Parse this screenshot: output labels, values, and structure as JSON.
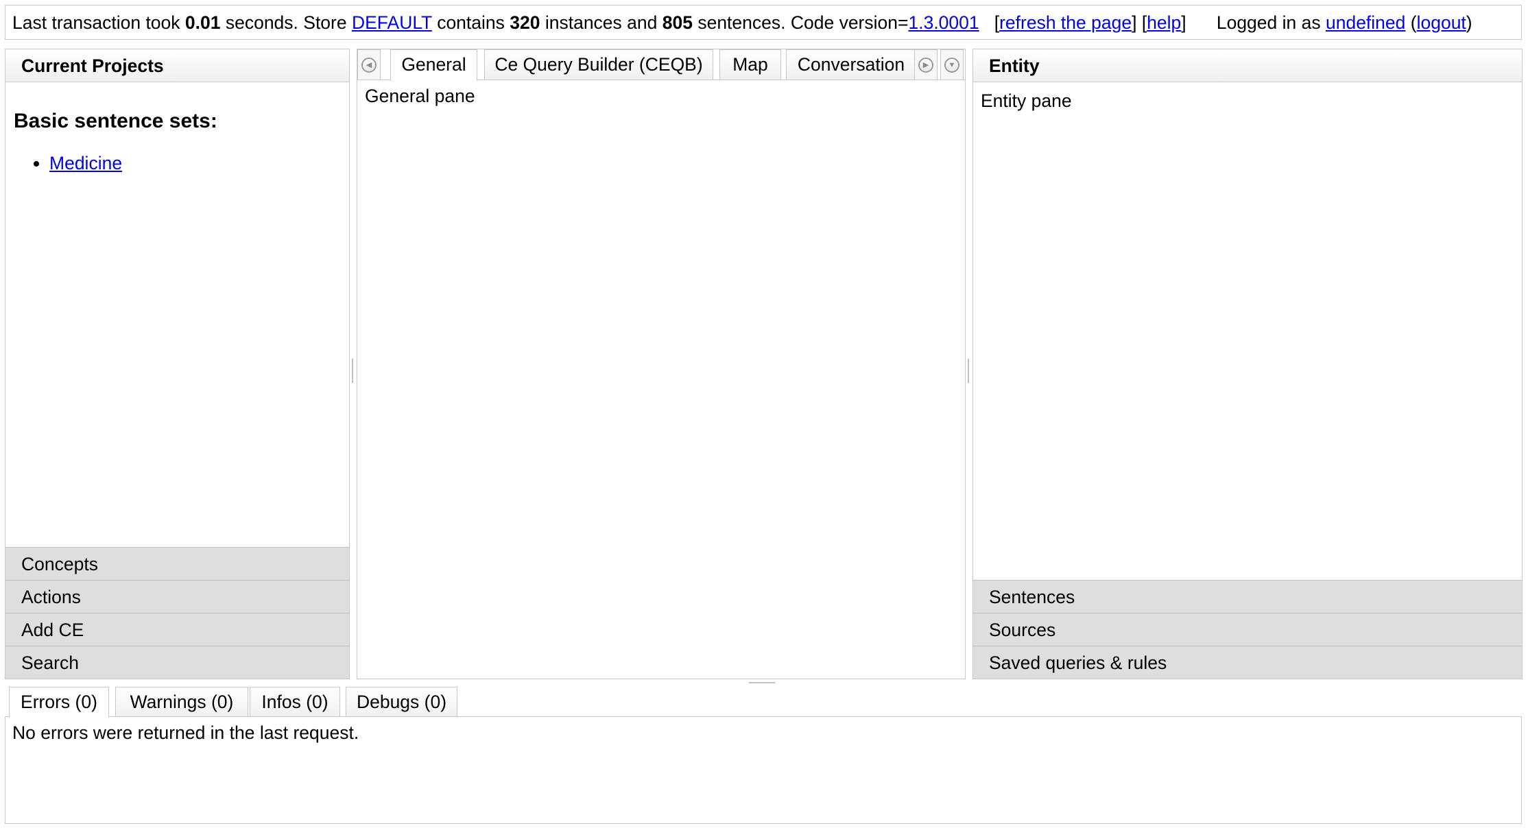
{
  "status": {
    "t1": "Last transaction took ",
    "seconds": "0.01",
    "t2": " seconds. Store ",
    "store": "DEFAULT",
    "t3": " contains ",
    "instances": "320",
    "t4": " instances and ",
    "sentences": "805",
    "t5": " sentences. Code version=",
    "version": "1.3.0001",
    "refresh": "refresh the page",
    "help": "help",
    "logged_in": "Logged in as ",
    "user": "undefined",
    "logout": "logout"
  },
  "left_pane": {
    "title": "Current Projects",
    "heading": "Basic sentence sets:",
    "projects": [
      "Medicine"
    ],
    "accordion": [
      "Concepts",
      "Actions",
      "Add CE",
      "Search"
    ]
  },
  "center_pane": {
    "tabs": [
      "General",
      "Ce Query Builder (CEQB)",
      "Map",
      "Conversation"
    ],
    "active_tab": "General",
    "body_text": "General pane"
  },
  "right_pane": {
    "title": "Entity",
    "body_text": "Entity pane",
    "accordion": [
      "Sentences",
      "Sources",
      "Saved queries & rules"
    ]
  },
  "log_panel": {
    "tabs": [
      "Errors (0)",
      "Warnings (0)",
      "Infos (0)",
      "Debugs (0)"
    ],
    "active_tab": "Errors (0)",
    "message": "No errors were returned in the last request."
  }
}
